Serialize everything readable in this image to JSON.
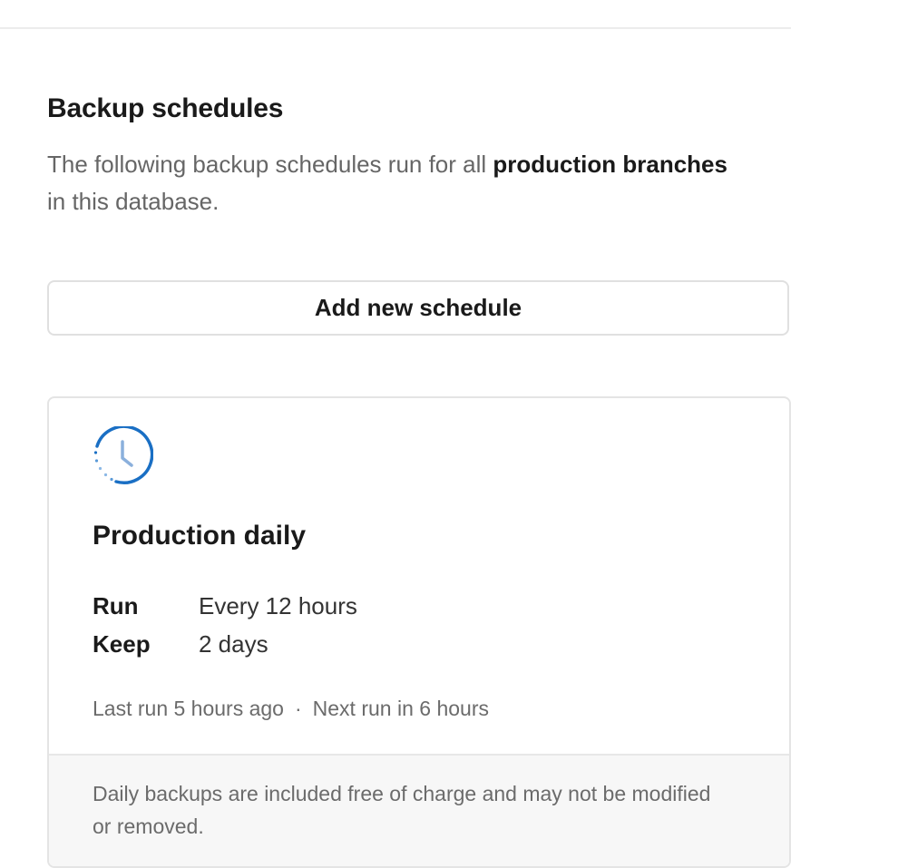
{
  "section": {
    "title": "Backup schedules",
    "description_prefix": "The following backup schedules run for all ",
    "description_bold": "production branches",
    "description_suffix": " in this database."
  },
  "add_button": {
    "label": "Add new schedule"
  },
  "schedule_card": {
    "icon": "clock-icon",
    "accent_color": "#1a6fc4",
    "title": "Production daily",
    "details": [
      {
        "label": "Run",
        "value": "Every 12 hours"
      },
      {
        "label": "Keep",
        "value": "2 days"
      }
    ],
    "last_run": "Last run 5 hours ago",
    "separator": "·",
    "next_run": "Next run in 6 hours",
    "footer_note": "Daily backups are included free of charge and may not be modified or removed."
  }
}
